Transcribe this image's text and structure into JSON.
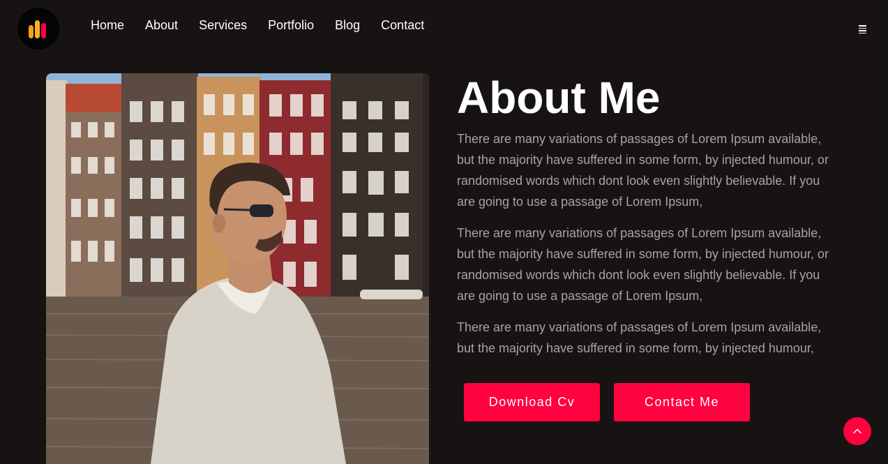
{
  "nav": {
    "items": [
      {
        "label": "Home"
      },
      {
        "label": "About"
      },
      {
        "label": "Services"
      },
      {
        "label": "Portfolio"
      },
      {
        "label": "Blog"
      },
      {
        "label": "Contact"
      }
    ]
  },
  "icons": {
    "logo": "bars-logo-icon",
    "menu": "hamburger-menu-icon",
    "scroll_top": "chevron-up-icon"
  },
  "about": {
    "title": "About Me",
    "paragraphs": [
      "There are many variations of passages of Lorem Ipsum available, but the majority have suffered in some form, by injected humour, or randomised words which dont look even slightly believable. If you are going to use a passage of Lorem Ipsum,",
      "There are many variations of passages of Lorem Ipsum available, but the majority have suffered in some form, by injected humour, or randomised words which dont look even slightly believable. If you are going to use a passage of Lorem Ipsum,",
      "There are many variations of passages of Lorem Ipsum available, but the majority have suffered in some form, by injected humour,"
    ],
    "buttons": {
      "download_cv": "Download Cv",
      "contact_me": "Contact Me"
    }
  },
  "colors": {
    "background": "#181313",
    "accent": "#ff0340",
    "body_text": "#a6a3a3"
  }
}
